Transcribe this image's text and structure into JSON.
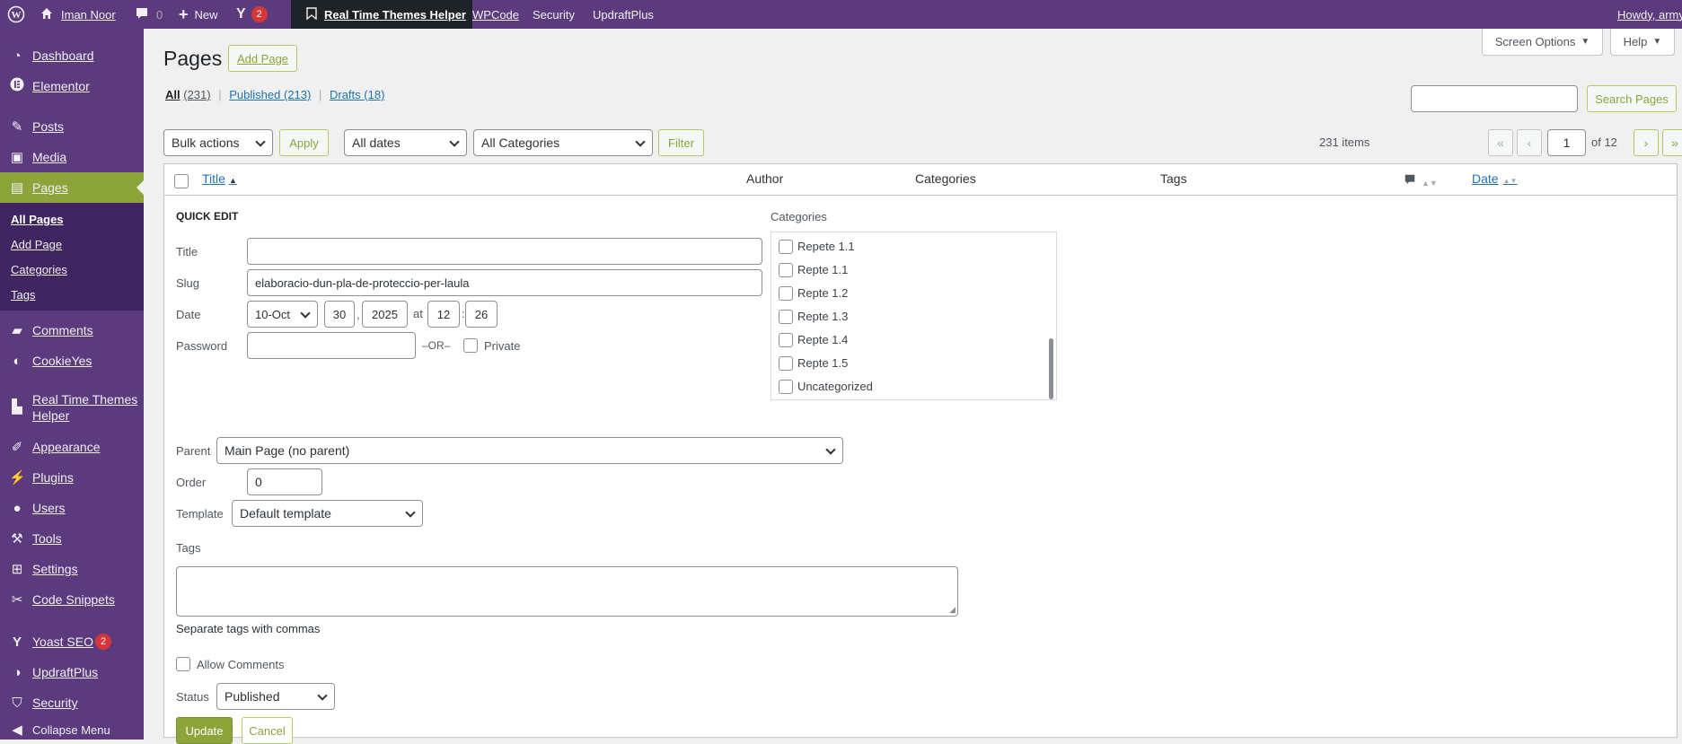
{
  "adminbar": {
    "site_name": "Iman Noor",
    "comments_count": "0",
    "new_label": "New",
    "yoast_count": "2",
    "plugin_link": "Real Time Themes Helper",
    "wpcode": "WPCode",
    "security": "Security",
    "updraft": "UpdraftPlus",
    "howdy": "Howdy, army"
  },
  "sidebar": {
    "items": [
      {
        "label": "Dashboard",
        "icon": "dashboard-icon"
      },
      {
        "label": "Elementor",
        "icon": "elementor-icon"
      },
      {
        "label": "Posts",
        "icon": "pin-icon"
      },
      {
        "label": "Media",
        "icon": "media-icon"
      },
      {
        "label": "Pages",
        "icon": "pages-icon"
      },
      {
        "label": "Comments",
        "icon": "comment-icon"
      },
      {
        "label": "CookieYes",
        "icon": "cookie-icon"
      },
      {
        "label": "Real Time Themes Helper",
        "icon": "helper-icon"
      },
      {
        "label": "Appearance",
        "icon": "brush-icon"
      },
      {
        "label": "Plugins",
        "icon": "plugin-icon"
      },
      {
        "label": "Users",
        "icon": "users-icon"
      },
      {
        "label": "Tools",
        "icon": "tools-icon"
      },
      {
        "label": "Settings",
        "icon": "settings-icon"
      },
      {
        "label": "Code Snippets",
        "icon": "code-icon"
      },
      {
        "label": "Yoast SEO",
        "icon": "yoast-icon",
        "badge": "2"
      },
      {
        "label": "UpdraftPlus",
        "icon": "updraft-icon"
      },
      {
        "label": "Security",
        "icon": "shield-icon"
      },
      {
        "label": "Collapse Menu",
        "icon": "collapse-icon"
      }
    ],
    "submenu": [
      "All Pages",
      "Add Page",
      "Categories",
      "Tags"
    ]
  },
  "header": {
    "title": "Pages",
    "add_page": "Add Page",
    "screen_options": "Screen Options",
    "help": "Help"
  },
  "filters": {
    "all": "All",
    "all_count": "(231)",
    "published": "Published",
    "published_count": "(213)",
    "drafts": "Drafts",
    "drafts_count": "(18)",
    "search_btn": "Search Pages",
    "bulk": "Bulk actions",
    "apply": "Apply",
    "dates": "All dates",
    "categories": "All Categories",
    "filter": "Filter",
    "items": "231 items",
    "first": "«",
    "prev": "‹",
    "page": "1",
    "of": "of 12",
    "next": "›",
    "last": "»"
  },
  "table": {
    "columns": [
      "Title",
      "Author",
      "Categories",
      "Tags",
      "Date"
    ]
  },
  "quickedit": {
    "heading": "QUICK EDIT",
    "title_label": "Title",
    "title_value": "",
    "slug_label": "Slug",
    "slug_value": "elaboracio-dun-pla-de-proteccio-per-laula",
    "date_label": "Date",
    "month": "10-Oct",
    "day": "30",
    "year": "2025",
    "at": "at",
    "hour": "12",
    "colon": ":",
    "minute": "26",
    "comma": ",",
    "password_label": "Password",
    "or": "–OR–",
    "private": "Private",
    "categories_label": "Categories",
    "categories": [
      "Repete 1.1",
      "Repte 1.1",
      "Repte 1.2",
      "Repte 1.3",
      "Repte 1.4",
      "Repte 1.5",
      "Uncategorized"
    ],
    "parent_label": "Parent",
    "parent_value": "Main Page (no parent)",
    "order_label": "Order",
    "order_value": "0",
    "template_label": "Template",
    "template_value": "Default template",
    "tags_label": "Tags",
    "tags_hint": "Separate tags with commas",
    "allow_comments": "Allow Comments",
    "status_label": "Status",
    "status_value": "Published",
    "update": "Update",
    "cancel": "Cancel"
  }
}
